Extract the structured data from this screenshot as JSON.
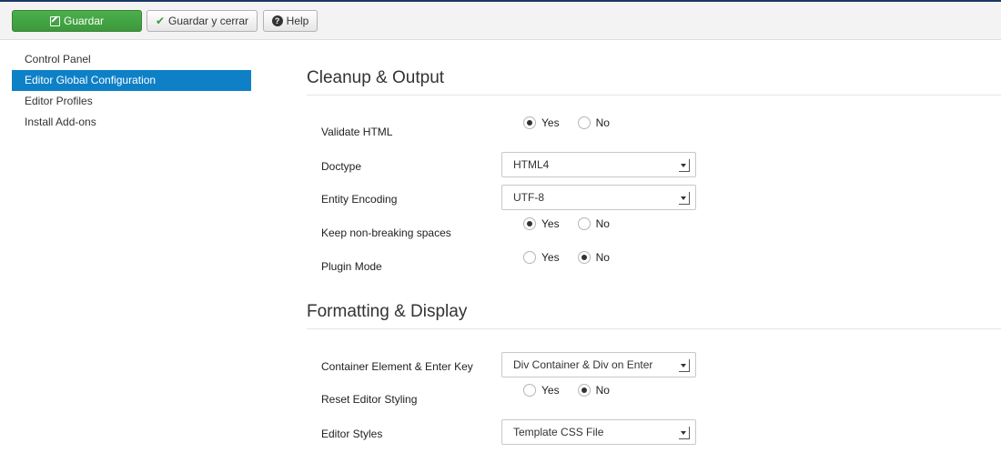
{
  "toolbar": {
    "save_label": "Guardar",
    "save_close_label": "Guardar y cerrar",
    "help_label": "Help"
  },
  "sidebar": {
    "items": [
      {
        "label": "Control Panel",
        "active": false
      },
      {
        "label": "Editor Global Configuration",
        "active": true
      },
      {
        "label": "Editor Profiles",
        "active": false
      },
      {
        "label": "Install Add-ons",
        "active": false
      }
    ]
  },
  "sections": {
    "cleanup": {
      "title": "Cleanup & Output",
      "validate_html": {
        "label": "Validate HTML",
        "yes": "Yes",
        "no": "No",
        "selected": "Yes"
      },
      "doctype": {
        "label": "Doctype",
        "value": "HTML4"
      },
      "entity_encoding": {
        "label": "Entity Encoding",
        "value": "UTF-8"
      },
      "keep_nbsp": {
        "label": "Keep non-breaking spaces",
        "yes": "Yes",
        "no": "No",
        "selected": "Yes"
      },
      "plugin_mode": {
        "label": "Plugin Mode",
        "yes": "Yes",
        "no": "No",
        "selected": "No"
      }
    },
    "formatting": {
      "title": "Formatting & Display",
      "container_element": {
        "label": "Container Element & Enter Key",
        "value": "Div Container & Div on Enter"
      },
      "reset_styling": {
        "label": "Reset Editor Styling",
        "yes": "Yes",
        "no": "No",
        "selected": "No"
      },
      "editor_styles": {
        "label": "Editor Styles",
        "value": "Template CSS File"
      }
    }
  },
  "colors": {
    "accent": "#0e80c7",
    "save_button": "#4cae4c",
    "top_line": "#1a3867"
  },
  "icons": {
    "save": "edit-icon",
    "save_close": "check-icon",
    "help": "question-circle-icon"
  }
}
